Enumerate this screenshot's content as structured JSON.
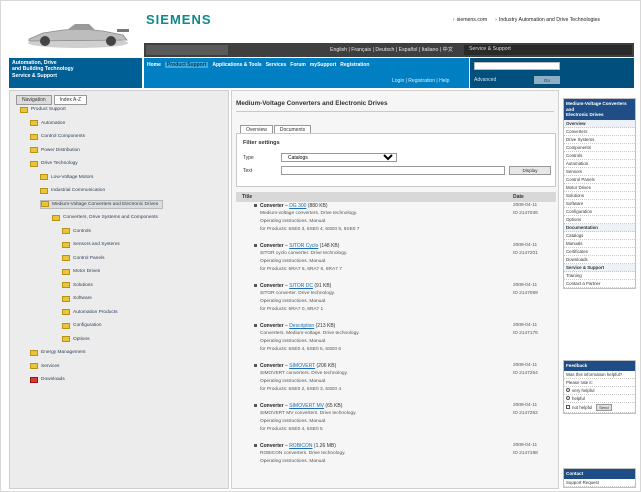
{
  "header": {
    "brand": "SIEMENS",
    "top_links": [
      "siemens.com",
      "Industry Automation and Drive Technologies"
    ],
    "languages": "English | Français | Deutsch | Español | Italiano | 中文",
    "portal_label": "Service & Support",
    "left_title": [
      "Automation, Drive",
      "and Building Technology",
      "Service & Support"
    ],
    "nav_items": [
      "Home",
      "Product Support",
      "Applications & Tools",
      "Services",
      "Forum",
      "mySupport",
      "Registration"
    ],
    "nav_active_index": 1,
    "nav_sub": "Login | Registration | Help",
    "search_placeholder": "",
    "search_label": "Advanced",
    "search_button": "Go"
  },
  "sidebar": {
    "tabs": [
      "Navigation",
      "Index A-Z"
    ],
    "active_tab": 0,
    "tree": [
      {
        "label": "Product Support",
        "level": 0,
        "red": false
      },
      {
        "label": "Automation",
        "level": 1,
        "red": false
      },
      {
        "label": "Control Components",
        "level": 1,
        "red": false
      },
      {
        "label": "Power Distribution",
        "level": 1,
        "red": false
      },
      {
        "label": "Drive Technology",
        "level": 1,
        "red": false
      },
      {
        "label": "Low-Voltage Motors",
        "level": 2,
        "red": false
      },
      {
        "label": "Industrial Communication",
        "level": 2,
        "red": false
      },
      {
        "label": "Medium-Voltage Converters and Electronic Drives",
        "level": 2,
        "red": false,
        "highlighted": true
      },
      {
        "label": "Converters, Drive Systems and Components",
        "level": 3,
        "red": false
      },
      {
        "label": "Controls",
        "level": 4,
        "red": false
      },
      {
        "label": "Sensors and Systems",
        "level": 4,
        "red": false
      },
      {
        "label": "Control Panels",
        "level": 4,
        "red": false
      },
      {
        "label": "Motor Drives",
        "level": 4,
        "red": false
      },
      {
        "label": "Solutions",
        "level": 4,
        "red": false
      },
      {
        "label": "Software",
        "level": 4,
        "red": false
      },
      {
        "label": "Automation Products",
        "level": 4,
        "red": false
      },
      {
        "label": "Configuration",
        "level": 4,
        "red": false
      },
      {
        "label": "Options",
        "level": 4,
        "red": false
      },
      {
        "label": "Energy Management",
        "level": 1,
        "red": false
      },
      {
        "label": "Services",
        "level": 1,
        "red": false
      },
      {
        "label": "Downloads",
        "level": 1,
        "red": true
      }
    ]
  },
  "main": {
    "title": "Medium-Voltage Converters and Electronic Drives",
    "tabs": [
      "Overview",
      "Documents"
    ],
    "active_tab": 1,
    "filter": {
      "heading": "Filter settings",
      "type_label": "Type",
      "type_value": "Catalogs",
      "text_label": "Text",
      "text_value": "",
      "apply_label": "Display"
    },
    "columns": [
      "Title",
      "Date"
    ],
    "rows": [
      {
        "prefix": "Converter",
        "link": "DG 300",
        "size": "(880 KB)",
        "desc": "Medium-voltage converters. Drive technology.",
        "desc2": "Operating instructions. Manual.",
        "prod": "for Products: 6SE0 3, 6SE0 4, 6SE0 5, 6SE0 7",
        "date": "2008-04-11",
        "date2": "ID 2147036"
      },
      {
        "prefix": "Converter",
        "link": "SITOR Cyclo",
        "size": "(148 KB)",
        "desc": "SITOR cyclo converter. Drive technology.",
        "desc2": "Operating instructions. Manual.",
        "prod": "for Products: 6RA7 5, 6RA7 6, 6RA7 7",
        "date": "2008-04-11",
        "date2": "ID 2147201"
      },
      {
        "prefix": "Converter",
        "link": "SITOR DC",
        "size": "(91 KB)",
        "desc": "SITOR converter. Drive technology.",
        "desc2": "Operating instructions. Manual.",
        "prod": "for Products: 6RA7 0, 6RA7 1",
        "date": "2008-04-11",
        "date2": "ID 2147089"
      },
      {
        "prefix": "Converter",
        "link": "Description",
        "size": "(213 KB)",
        "desc": "Converters. Medium-voltage. Drive technology.",
        "desc2": "Operating instructions. Manual.",
        "prod": "for Products: 6SE0 4, 6SE0 5, 6SE0 6",
        "date": "2008-04-11",
        "date2": "ID 2147176"
      },
      {
        "prefix": "Converter",
        "link": "SIMOVERT",
        "size": "(206 KB)",
        "desc": "SIMOVERT converters. Drive technology.",
        "desc2": "Operating instructions. Manual.",
        "prod": "for Products: 6SE0 2, 6SE0 3, 6SE0 4",
        "date": "2008-04-11",
        "date2": "ID 2147254"
      },
      {
        "prefix": "Converter",
        "link": "SIMOVERT MV",
        "size": "(65 KB)",
        "desc": "SIMOVERT MV converters. Drive technology.",
        "desc2": "Operating instructions. Manual.",
        "prod": "for Products: 6SE0 4, 6SE0 5",
        "date": "2008-04-11",
        "date2": "ID 2147262"
      },
      {
        "prefix": "Converter",
        "link": "ROBICON",
        "size": "(1.26 MB)",
        "desc": "ROBICON converters. Drive technology.",
        "desc2": "Operating instructions. Manual.",
        "prod": "",
        "date": "2008-04-11",
        "date2": "ID 2147198"
      }
    ]
  },
  "right": {
    "box1_title": [
      "Medium-Voltage Converters and",
      "Electronic Drives"
    ],
    "box1_links": [
      {
        "t": "Overview",
        "sec": true
      },
      {
        "t": "Converters",
        "sec": false
      },
      {
        "t": "Drive Systems",
        "sec": false
      },
      {
        "t": "Components",
        "sec": false
      },
      {
        "t": "Controls",
        "sec": false
      },
      {
        "t": "Automation",
        "sec": false
      },
      {
        "t": "Sensors",
        "sec": false
      },
      {
        "t": "Control Panels",
        "sec": false
      },
      {
        "t": "Motor Drives",
        "sec": false
      },
      {
        "t": "Solutions",
        "sec": false
      },
      {
        "t": "Software",
        "sec": false
      },
      {
        "t": "Configuration",
        "sec": false
      },
      {
        "t": "Options",
        "sec": false
      },
      {
        "t": "Documentation",
        "sec": true
      },
      {
        "t": "Catalogs",
        "sec": false
      },
      {
        "t": "Manuals",
        "sec": false
      },
      {
        "t": "Certificates",
        "sec": false
      },
      {
        "t": "Downloads",
        "sec": false
      },
      {
        "t": "Service & Support",
        "sec": true
      },
      {
        "t": "Training",
        "sec": false
      },
      {
        "t": "Contact a Partner",
        "sec": false
      }
    ],
    "box2_title": [
      "Feedback"
    ],
    "box2_text": [
      "Was this information helpful?",
      "Please rate it:"
    ],
    "box2_opts": [
      "very helpful",
      "helpful",
      "not helpful"
    ],
    "box2_button": "Send",
    "box3_title": [
      "Contact"
    ],
    "box3_links": [
      "Support Request"
    ]
  }
}
